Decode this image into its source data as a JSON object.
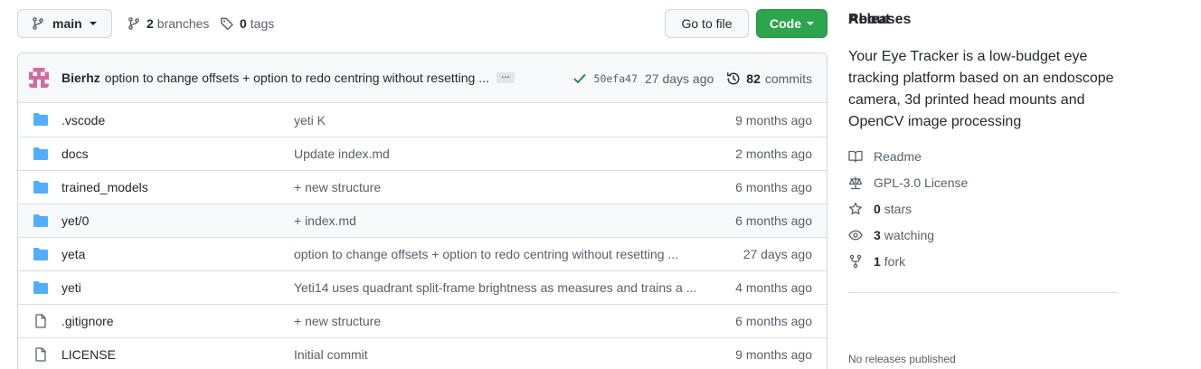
{
  "topbar": {
    "branch": "main",
    "branches_count": "2",
    "branches_label": "branches",
    "tags_count": "0",
    "tags_label": "tags",
    "go_to_file": "Go to file",
    "code": "Code"
  },
  "latest_commit": {
    "author": "Bierhz",
    "message": "option to change offsets + option to redo centring without resetting ...",
    "ellipsis": "…",
    "sha": "50efa47",
    "age": "27 days ago",
    "commits_count": "82",
    "commits_label": "commits"
  },
  "files": [
    {
      "type": "folder",
      "name": ".vscode",
      "message": "yeti K",
      "age": "9 months ago"
    },
    {
      "type": "folder",
      "name": "docs",
      "message": "Update index.md",
      "age": "2 months ago"
    },
    {
      "type": "folder",
      "name": "trained_models",
      "message": "+ new structure",
      "age": "6 months ago"
    },
    {
      "type": "folder",
      "name": "yet/0",
      "message": "+ index.md",
      "age": "6 months ago"
    },
    {
      "type": "folder",
      "name": "yeta",
      "message": "option to change offsets + option to redo centring without resetting ...",
      "age": "27 days ago"
    },
    {
      "type": "folder",
      "name": "yeti",
      "message": "Yeti14 uses quadrant split-frame brightness as measures and trains a ...",
      "age": "4 months ago"
    },
    {
      "type": "file",
      "name": ".gitignore",
      "message": "+ new structure",
      "age": "6 months ago"
    },
    {
      "type": "file",
      "name": "LICENSE",
      "message": "Initial commit",
      "age": "9 months ago"
    }
  ],
  "about": {
    "title": "About",
    "description": "Your Eye Tracker is a low-budget eye tracking platform based on an endoscope camera, 3d printed head mounts and OpenCV image processing",
    "readme": "Readme",
    "license": "GPL-3.0 License",
    "stars_count": "0",
    "stars_label": "stars",
    "watching_count": "3",
    "watching_label": "watching",
    "forks_count": "1",
    "forks_label": "fork",
    "releases_title": "Releases",
    "releases_none": "No releases published"
  },
  "colors": {
    "accent_green": "#2da44e",
    "folder_blue": "#54aeff",
    "check_green": "#1a7f37"
  }
}
